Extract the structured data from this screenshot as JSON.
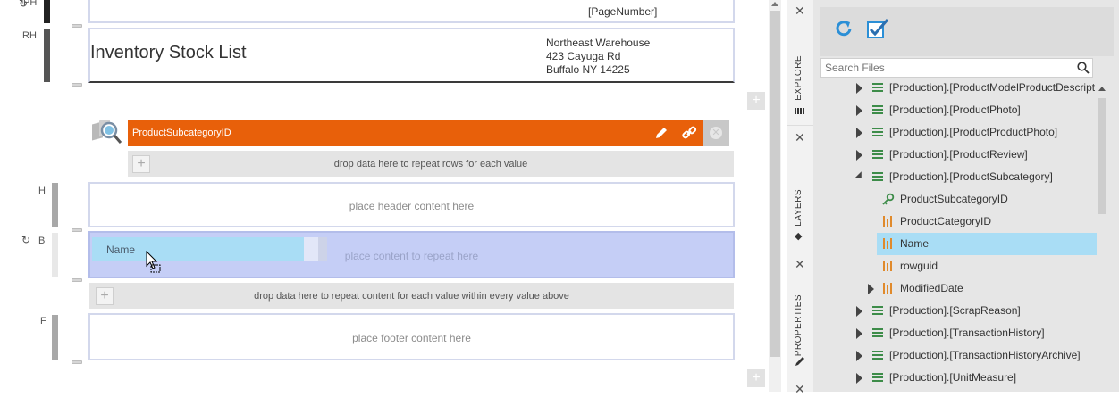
{
  "report": {
    "page_number": "[PageNumber]",
    "title": "Inventory Stock List",
    "address": [
      "Northeast Warehouse",
      "423 Cayuga Rd",
      "Buffalo NY 14225"
    ],
    "group_field": "ProductSubcategoryID",
    "drop_rows_text": "drop data here to repeat rows for each value",
    "header_placeholder": "place header content here",
    "body_placeholder": "place content to repeat here",
    "body_field": "Name",
    "drop_nested_text": "drop data here to repeat content for each value within every value above",
    "footer_placeholder": "place footer content here",
    "plus_symbol": "+"
  },
  "bands": {
    "page_header": "PH",
    "report_header": "RH",
    "header": "H",
    "body": "B",
    "footer": "F"
  },
  "right_panel": {
    "search_placeholder": "Search Files",
    "tabs": {
      "explore": "EXPLORE",
      "layers": "LAYERS",
      "properties": "PROPERTIES"
    },
    "tree": [
      {
        "label": "[Production].[ProductModelProductDescript",
        "kind": "table",
        "indent": 0
      },
      {
        "label": "[Production].[ProductPhoto]",
        "kind": "table",
        "indent": 0
      },
      {
        "label": "[Production].[ProductProductPhoto]",
        "kind": "table",
        "indent": 0
      },
      {
        "label": "[Production].[ProductReview]",
        "kind": "table",
        "indent": 0
      },
      {
        "label": "[Production].[ProductSubcategory]",
        "kind": "table-open",
        "indent": 0
      },
      {
        "label": "ProductSubcategoryID",
        "kind": "key",
        "indent": 1
      },
      {
        "label": "ProductCategoryID",
        "kind": "column",
        "indent": 1
      },
      {
        "label": "Name",
        "kind": "column",
        "indent": 1,
        "selected": true
      },
      {
        "label": "rowguid",
        "kind": "column",
        "indent": 1
      },
      {
        "label": "ModifiedDate",
        "kind": "column-expandable",
        "indent": 1
      },
      {
        "label": "[Production].[ScrapReason]",
        "kind": "table",
        "indent": 0
      },
      {
        "label": "[Production].[TransactionHistory]",
        "kind": "table",
        "indent": 0
      },
      {
        "label": "[Production].[TransactionHistoryArchive]",
        "kind": "table",
        "indent": 0
      },
      {
        "label": "[Production].[UnitMeasure]",
        "kind": "table",
        "indent": 0
      }
    ],
    "colors": {
      "accent": "#2b8fd6",
      "selected": "#a9ddf5",
      "group": "#e8600a"
    }
  }
}
